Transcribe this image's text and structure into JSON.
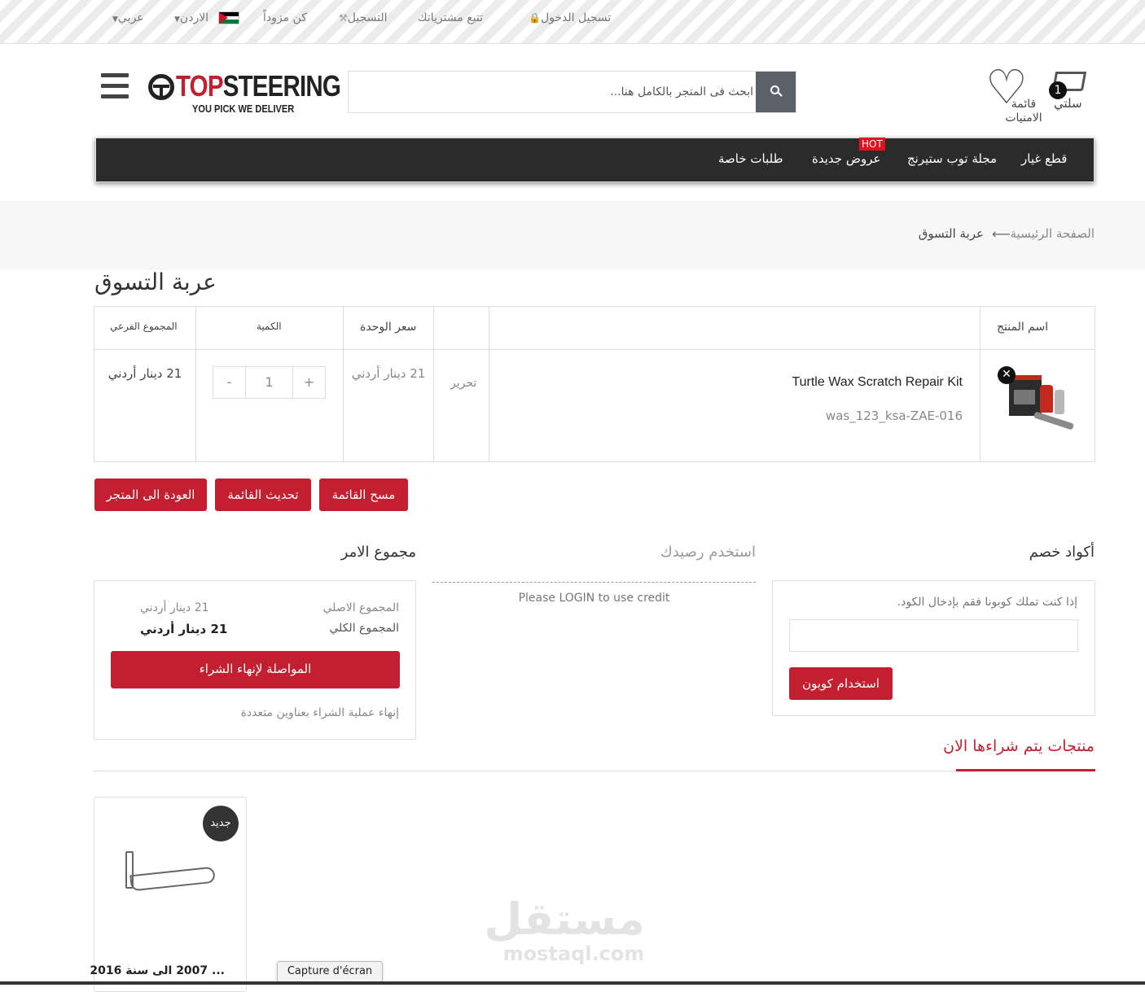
{
  "topbar": {
    "login": "تسجيل الدخول",
    "track": "تتبع مشترياتك",
    "register": "التسجيل",
    "supplier": "كن مزوداً",
    "country": "الاردن",
    "language": "عربي"
  },
  "header": {
    "logo_top": "TOP",
    "logo_steering": "STEERING",
    "logo_tagline": "YOU PICK WE DELIVER",
    "search_placeholder": "ابحث فى المتجر بالكامل هنا...",
    "wishlist_label": "قائمة الامنيات",
    "cart_label": "سلتي",
    "cart_count": "1"
  },
  "nav": {
    "items": [
      "قطع غيار",
      "مجلة توب ستيرنج",
      "عروض جديدة",
      "طلبات خاصة"
    ],
    "hot_badge": "HOT"
  },
  "breadcrumb": {
    "home": "الصفحة الرئيسية",
    "current": "عربة التسوق"
  },
  "page_title": "عربة التسوق",
  "cart_table": {
    "headers": {
      "product_name": "اسم المنتج",
      "unit_price": "سعر الوحدة",
      "quantity": "الكمية",
      "subtotal": "المجموع الفرعي"
    },
    "rows": [
      {
        "name": "Turtle Wax Scratch Repair Kit",
        "sku": "was_123_ksa-ZAE-016",
        "edit": "تحرير",
        "unit_price": "21 دينار أردني",
        "qty": "1",
        "minus": "-",
        "plus": "+",
        "subtotal": "21 دينار أردني"
      }
    ]
  },
  "cart_actions": {
    "clear": "مسح القائمة",
    "update": "تحديث القائمة",
    "continue": "العودة الى المتجر"
  },
  "coupon": {
    "title": "أكواد خصم",
    "hint": "إذا كنت تملك كوبونا فقم بإدخال الكود.",
    "button": "استخدام كوبون"
  },
  "credit": {
    "title": "استخدم رصيدك",
    "message": "Please LOGIN to use credit"
  },
  "totals": {
    "title": "مجموع الامر",
    "original_label": "المجموع الاصلي",
    "original_value": "21 دينار أردني",
    "grand_label": "المجموع الكلي",
    "grand_value": "21 دينار أردني",
    "checkout": "المواصلة لإنهاء الشراء",
    "multi_address": "إنهاء عملية الشراء بعناوين متعددة"
  },
  "bestsellers": {
    "title": "منتجات يتم شراءها الان",
    "products": [
      {
        "badge": "جديد",
        "title": "... 2007 الى سنة 2016"
      }
    ]
  },
  "watermark": {
    "arabic": "مستقل",
    "latin": "mostaql.com"
  },
  "tooltip": "Capture d'écran",
  "colors": {
    "accent": "#c21f30",
    "nav_bg": "#2b2b2b",
    "hot": "#e3101e"
  }
}
